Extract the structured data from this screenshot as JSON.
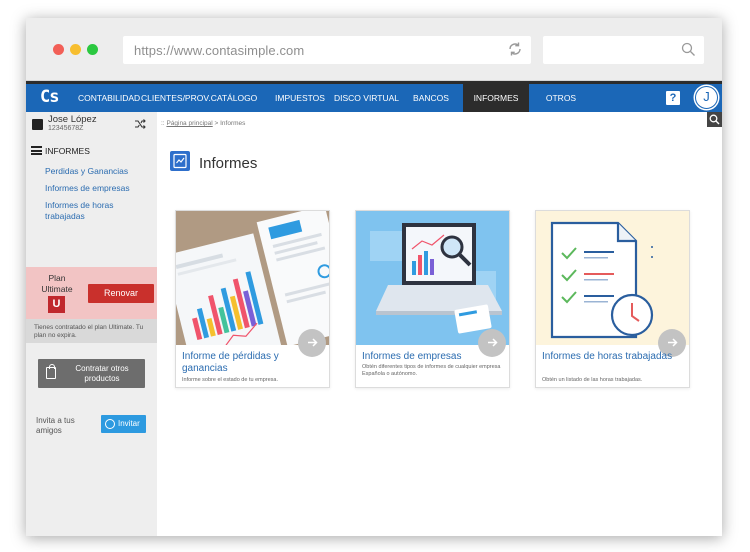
{
  "browser": {
    "url": "https://www.contasimple.com"
  },
  "nav": {
    "logo": "Cs",
    "items": [
      {
        "label": "CONTABILIDAD"
      },
      {
        "label": "CLIENTES/PROV."
      },
      {
        "label": "CATÁLOGO"
      },
      {
        "label": "IMPUESTOS"
      },
      {
        "label": "DISCO VIRTUAL"
      },
      {
        "label": "BANCOS"
      },
      {
        "label": "INFORMES"
      },
      {
        "label": "OTROS"
      }
    ],
    "active": "INFORMES",
    "help": "?",
    "avatar": "J",
    "accent_color": "#1b67b7"
  },
  "sidebar": {
    "user_name": "Jose López",
    "user_id": "12345678Z",
    "section_title": "INFORMES",
    "links": [
      {
        "label": "Perdidas y Ganancias"
      },
      {
        "label": "Informes de empresas"
      },
      {
        "label": "Informes de horas trabajadas"
      }
    ],
    "plan_label": "Plan Ultimate",
    "plan_badge": "U",
    "renew_label": "Renovar",
    "plan_note": "Tienes contratado el plan Ultimate. Tu plan no expira.",
    "contract_label": "Contratar otros productos",
    "invite_text": "Invita a tus amigos",
    "invite_button": "Invitar"
  },
  "main": {
    "breadcrumb_prefix": "::",
    "breadcrumb_home": "Página principal",
    "breadcrumb_current": "> Informes",
    "title": "Informes",
    "cards": [
      {
        "title": "Informe de pérdidas y ganancias",
        "description": "Informe sobre el estado de tu empresa."
      },
      {
        "title": "Informes de empresas",
        "description": "Obtén diferentes tipos de informes de cualquier empresa Española o autónomo."
      },
      {
        "title": "Informes de horas trabajadas",
        "description": "Obtén un listado de las horas trabajadas."
      }
    ]
  }
}
